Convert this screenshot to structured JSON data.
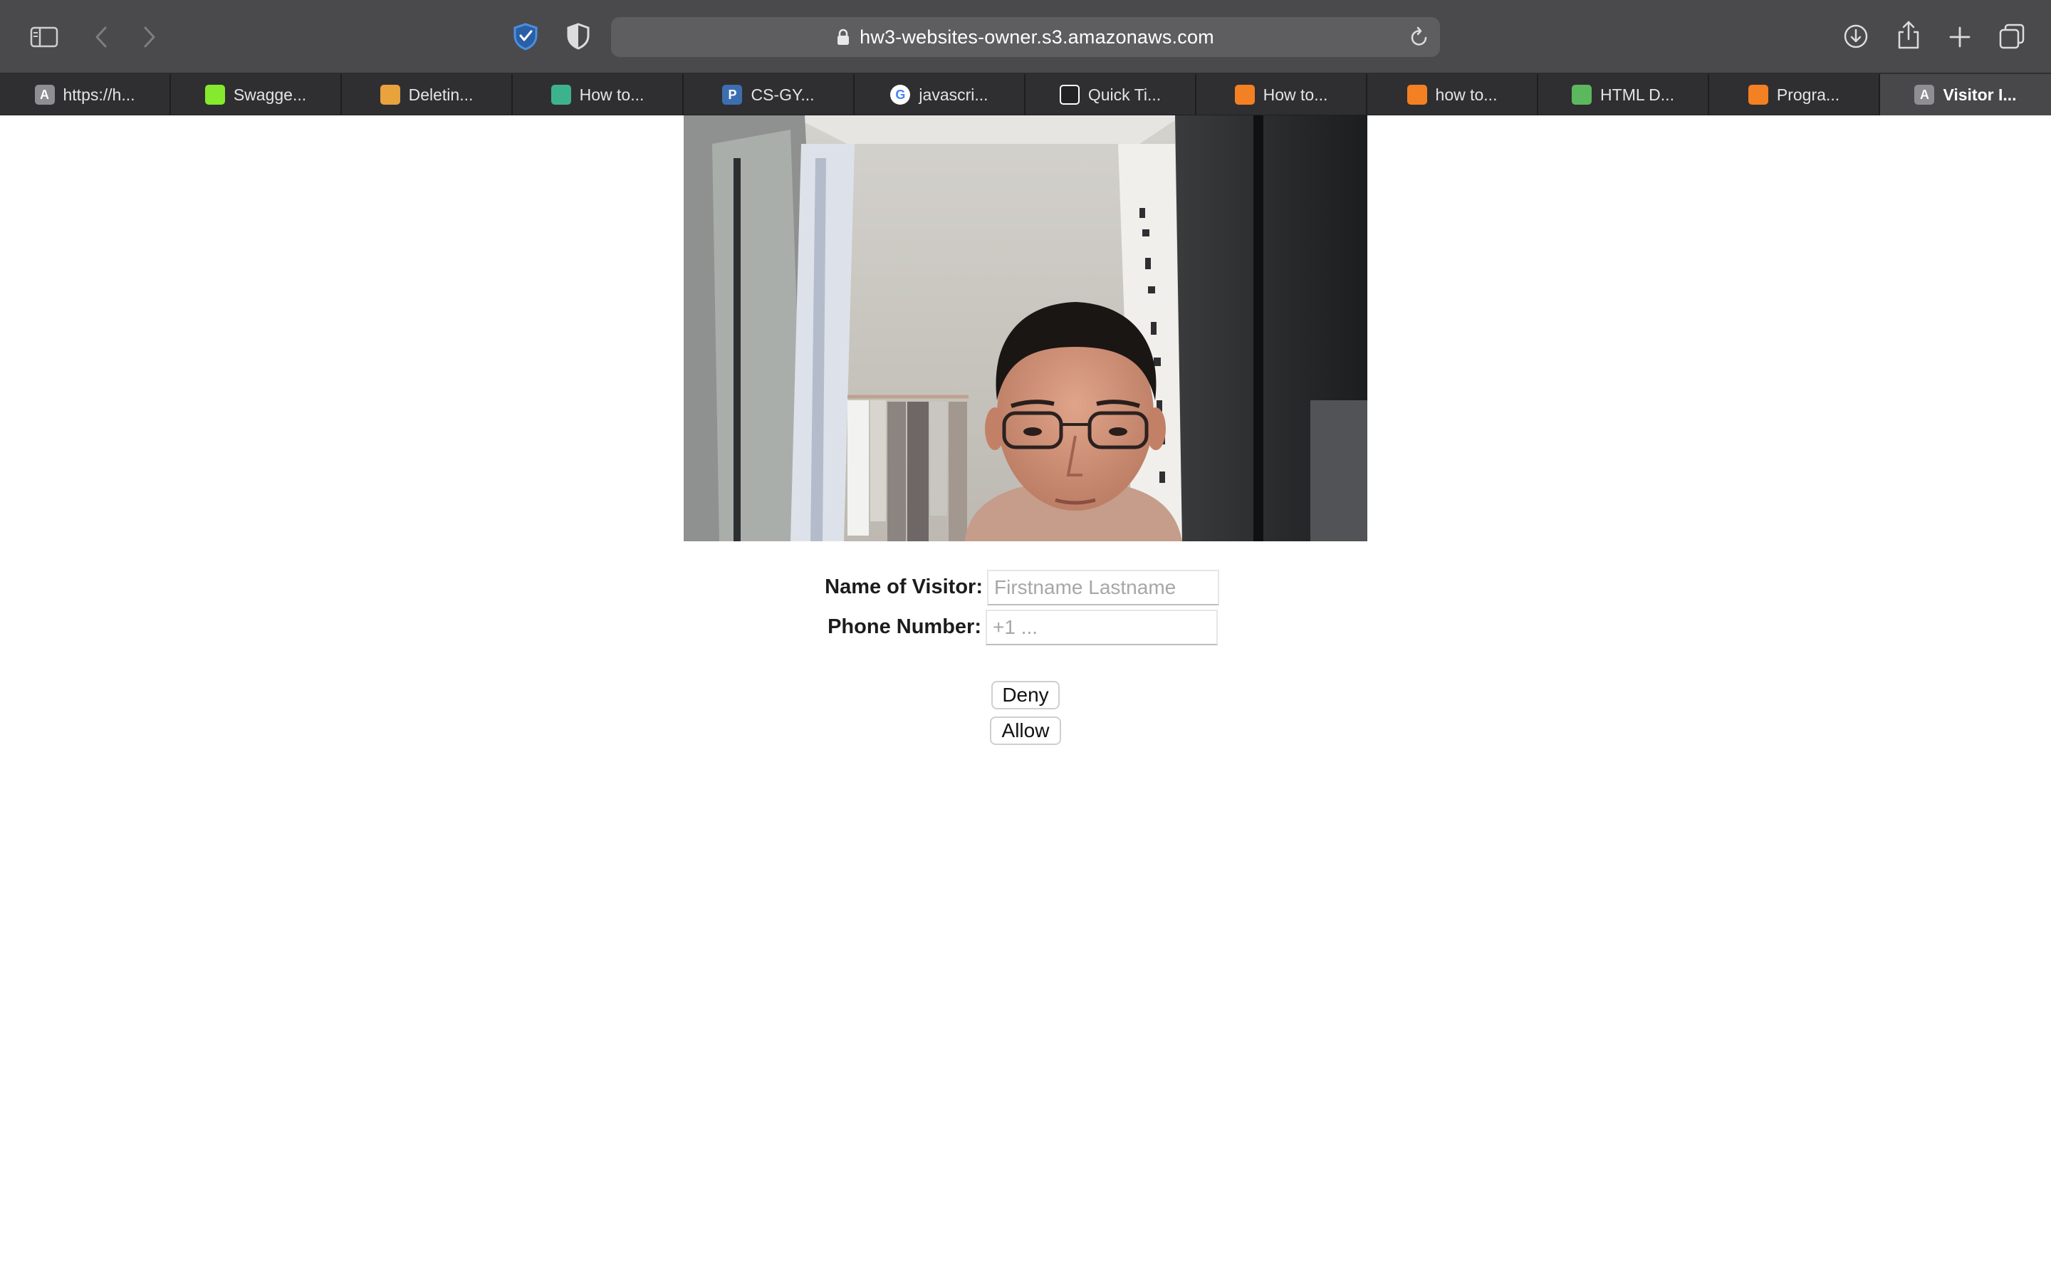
{
  "browser": {
    "url": "hw3-websites-owner.s3.amazonaws.com",
    "tabs": [
      {
        "label": "https://h...",
        "favicon_icon": "letter-a-favicon",
        "favicon_letter": "A",
        "favicon_color": "#8e8e93"
      },
      {
        "label": "Swagge...",
        "favicon_icon": "swagger-favicon",
        "favicon_letter": "",
        "favicon_color": "#85ea2d"
      },
      {
        "label": "Deletin...",
        "favicon_icon": "aws-box-favicon",
        "favicon_letter": "",
        "favicon_color": "#e8a33d"
      },
      {
        "label": "How to...",
        "favicon_icon": "shield-favicon",
        "favicon_letter": "",
        "favicon_color": "#3db38c"
      },
      {
        "label": "CS-GY...",
        "favicon_icon": "letter-p-favicon",
        "favicon_letter": "P",
        "favicon_color": "#3d6fb0"
      },
      {
        "label": "javascri...",
        "favicon_icon": "google-favicon",
        "favicon_letter": "G",
        "favicon_color": "#ffffff"
      },
      {
        "label": "Quick Ti...",
        "favicon_icon": "diamond-favicon",
        "favicon_letter": "",
        "favicon_color": "#222222"
      },
      {
        "label": "How to...",
        "favicon_icon": "stackoverflow-favicon",
        "favicon_letter": "",
        "favicon_color": "#f48024"
      },
      {
        "label": "how to...",
        "favicon_icon": "stackoverflow-favicon",
        "favicon_letter": "",
        "favicon_color": "#f48024"
      },
      {
        "label": "HTML D...",
        "favicon_icon": "html-favicon",
        "favicon_letter": "",
        "favicon_color": "#5cb85c"
      },
      {
        "label": "Progra...",
        "favicon_icon": "stackoverflow-favicon",
        "favicon_letter": "",
        "favicon_color": "#f48024"
      },
      {
        "label": "Visitor I...",
        "favicon_icon": "letter-a-favicon",
        "favicon_letter": "A",
        "favicon_color": "#8e8e93",
        "active": true
      }
    ],
    "toolbar_icons": [
      "sidebar-icon",
      "back-icon",
      "forward-icon",
      "privacy-shield-icon",
      "reader-shield-icon",
      "lock-icon",
      "reload-icon",
      "download-icon",
      "share-icon",
      "new-tab-icon",
      "tab-overview-icon"
    ],
    "accent": "#4a90e2"
  },
  "page": {
    "webcam_image": "webcam-visitor-photo",
    "form": {
      "name_label": "Name of Visitor:",
      "name_placeholder": "Firstname Lastname",
      "phone_label": "Phone Number:",
      "phone_placeholder": "+1 ..."
    },
    "buttons": {
      "deny": "Deny",
      "allow": "Allow"
    }
  }
}
